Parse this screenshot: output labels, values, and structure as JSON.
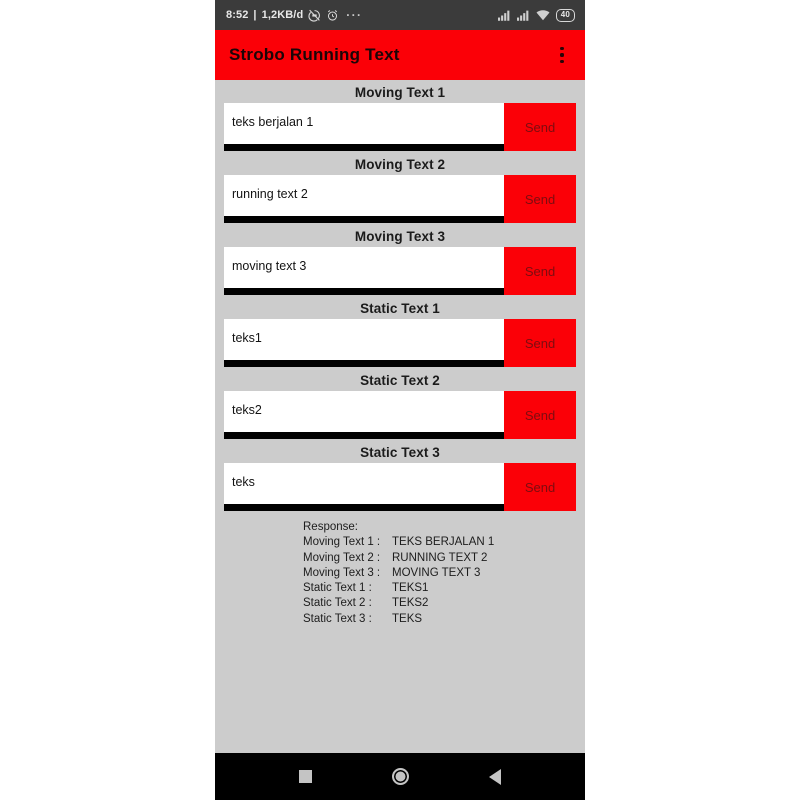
{
  "status_bar": {
    "time": "8:52",
    "separator": "|",
    "data_rate": "1,2KB/d",
    "dnd_icon": "do-not-disturb-icon",
    "alarm_icon": "alarm-clock-icon",
    "more_icon": "···",
    "signal_1_icon": "signal-bars-icon",
    "signal_2_icon": "signal-bars-icon",
    "wifi_icon": "wifi-icon",
    "battery_level": "40"
  },
  "app_bar": {
    "title": "Strobo Running Text",
    "overflow_icon": "overflow-menu-icon",
    "background": "#fb0007"
  },
  "fields": [
    {
      "label": "Moving Text 1",
      "value": "teks berjalan 1",
      "misspelled": "",
      "value_tail": "",
      "button": "Send"
    },
    {
      "label": "Moving Text 2",
      "value": "running ",
      "misspelled": "text",
      "value_tail": " 2",
      "button": "Send"
    },
    {
      "label": "Moving Text 3",
      "value": "moving ",
      "misspelled": "text",
      "value_tail": " 3",
      "button": "Send"
    },
    {
      "label": "Static Text 1",
      "value": "teks1",
      "misspelled": "",
      "value_tail": "",
      "button": "Send"
    },
    {
      "label": "Static Text 2",
      "value": "teks2",
      "misspelled": "",
      "value_tail": "",
      "button": "Send"
    },
    {
      "label": "Static Text 3",
      "value": "teks",
      "misspelled": "",
      "value_tail": "",
      "button": "Send"
    }
  ],
  "response": {
    "heading": "Response:",
    "rows": [
      {
        "key": "Moving Text 1 :",
        "value": "TEKS BERJALAN 1"
      },
      {
        "key": "Moving Text 2 :",
        "value": "RUNNING TEXT 2"
      },
      {
        "key": "Moving Text 3 :",
        "value": "MOVING TEXT 3"
      },
      {
        "key": "Static Text 1 :",
        "value": "TEKS1"
      },
      {
        "key": "Static Text 2 :",
        "value": "TEKS2"
      },
      {
        "key": "Static Text 3 :",
        "value": "TEKS"
      }
    ]
  },
  "nav_bar": {
    "recents_icon": "square-recents-icon",
    "home_icon": "circle-home-icon",
    "back_icon": "triangle-back-icon"
  }
}
